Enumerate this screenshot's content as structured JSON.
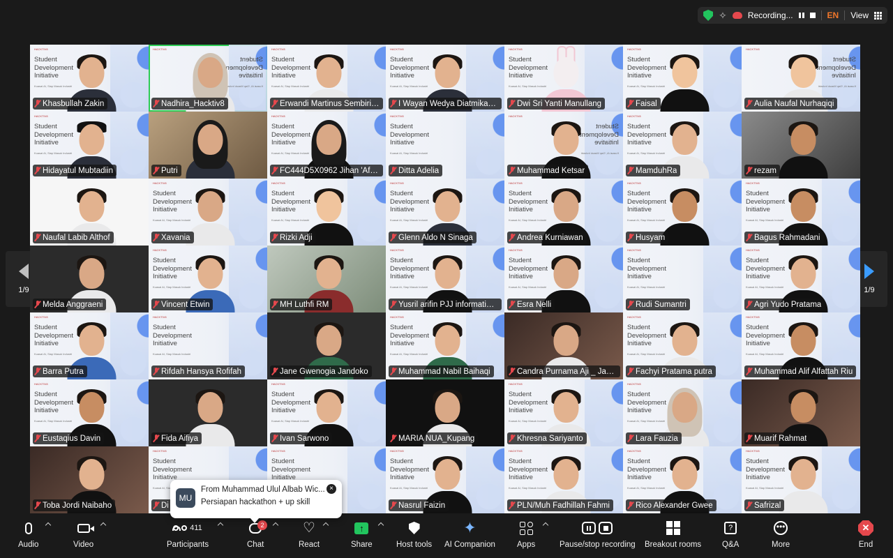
{
  "topbar": {
    "recording_label": "Recording...",
    "language": "EN",
    "view_label": "View",
    "colors": {
      "security": "#22c55e",
      "recording": "#e5484d",
      "language": "#f0772b"
    }
  },
  "pager": {
    "left_label": "1/9",
    "right_label": "1/9"
  },
  "slide": {
    "logo": "HACKTIV8",
    "line1": "Student",
    "line2": "Development",
    "line3": "Initiative",
    "small1": "Kuasai AI,",
    "small2": "Siap Masuk Industri"
  },
  "participants": [
    "Khasbullah Zakin",
    "Nadhira_Hacktiv8",
    "Erwandi Martinus Sembiring",
    "I Wayan Wedya Diatmika M...",
    "Dwi Sri Yanti Manullang",
    "Faisal",
    "Aulia Naufal Nurhaqiqi",
    "Hidayatul Mubtadiin",
    "Putri",
    "FC444D5X0962 Jihan 'Afina",
    "Ditta Adelia",
    "Muhammad Ketsar",
    "MamduhRa",
    "rezam",
    "Naufal Labib Althof",
    "Xavania",
    "Rizki Adji",
    "Glenn Aldo N Sinaga",
    "Andrea Kurniawan",
    "Husyam",
    "Bagus Rahmadani",
    "Melda Anggraeni",
    "Vincent Etwin",
    "MH Luthfi RM",
    "Yusril arifin PJJ informatika...",
    "Esra Nelli",
    "Rudi Sumantri",
    "Agri Yudo Pratama",
    "Barra Putra",
    "Rifdah Hansya Rofifah",
    "Jane Gwenogia Jandoko",
    "Muhammad Nabil Baihaqi",
    "Candra Purnama Aji _ Jam...",
    "Fachyi Pratama putra",
    "Muhammad Alif Alfattah Riu",
    "Eustaqius Davin",
    "Fida Aifiya",
    "Ivan Sarwono",
    "MARIA NUA_Kupang",
    "Khresna Sariyanto",
    "Lara Fauzia",
    "Muarif Rahmat",
    "Toba Jordi Naibaho",
    "Di",
    "",
    "Nasrul Faizin",
    "PLN/Muh Fadhillah Fahmi",
    "Rico Alexander Gwee",
    "Safrizal"
  ],
  "chat_popup": {
    "avatar": "MU",
    "from": "From Muhammad Ulul Albab Wic...",
    "message": "Persiapan hackathon + up skill",
    "close": "×"
  },
  "toolbar": {
    "audio": "Audio",
    "video": "Video",
    "participants": "Participants",
    "participant_count": "411",
    "chat": "Chat",
    "chat_badge": "2",
    "react": "React",
    "share": "Share",
    "host_tools": "Host tools",
    "ai_companion": "AI Companion",
    "apps": "Apps",
    "pause_stop": "Pause/stop recording",
    "breakout": "Breakout rooms",
    "qa": "Q&A",
    "more": "More",
    "end": "End",
    "icons": {
      "heart": "♡",
      "share": "↑",
      "ai": "✦",
      "qa": "?",
      "more": "•••",
      "end": "✕",
      "sparkle": "✧"
    }
  }
}
